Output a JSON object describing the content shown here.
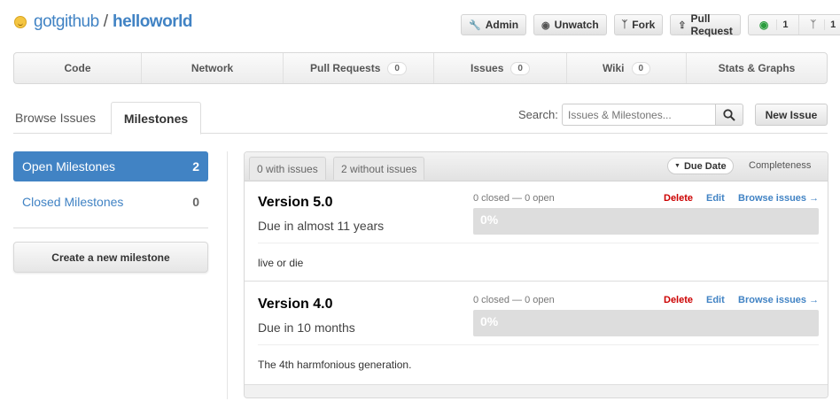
{
  "repo": {
    "owner": "gotgithub",
    "separator": "/",
    "name": "helloworld"
  },
  "actions": {
    "admin": "Admin",
    "unwatch": "Unwatch",
    "fork": "Fork",
    "pull_request": "Pull Request",
    "watchers": "1",
    "forks": "1"
  },
  "nav": {
    "tabs": [
      {
        "label": "Code"
      },
      {
        "label": "Network"
      },
      {
        "label": "Pull Requests",
        "count": "0"
      },
      {
        "label": "Issues",
        "count": "0"
      },
      {
        "label": "Wiki",
        "count": "0"
      },
      {
        "label": "Stats & Graphs"
      }
    ]
  },
  "subtabs": {
    "browse": "Browse Issues",
    "milestones": "Milestones"
  },
  "search": {
    "label": "Search:",
    "placeholder": "Issues & Milestones..."
  },
  "new_issue": "New Issue",
  "sidebar": {
    "open": {
      "label": "Open Milestones",
      "count": "2"
    },
    "closed": {
      "label": "Closed Milestones",
      "count": "0"
    },
    "create": "Create a new milestone"
  },
  "filters": {
    "with_issues": "0 with issues",
    "without_issues": "2 without issues",
    "sort_due": "Due Date",
    "sort_completeness": "Completeness"
  },
  "milestones": [
    {
      "title": "Version 5.0",
      "due": "Due in almost 11 years",
      "stats": "0 closed — 0 open",
      "progress": "0%",
      "delete": "Delete",
      "edit": "Edit",
      "browse": "Browse issues →",
      "description": "live or die"
    },
    {
      "title": "Version 4.0",
      "due": "Due in 10 months",
      "stats": "0 closed — 0 open",
      "progress": "0%",
      "delete": "Delete",
      "edit": "Edit",
      "browse": "Browse issues →",
      "description": "The 4th harmfonious generation."
    }
  ],
  "colors": {
    "accent": "#4183c4",
    "danger": "#cc0000"
  }
}
